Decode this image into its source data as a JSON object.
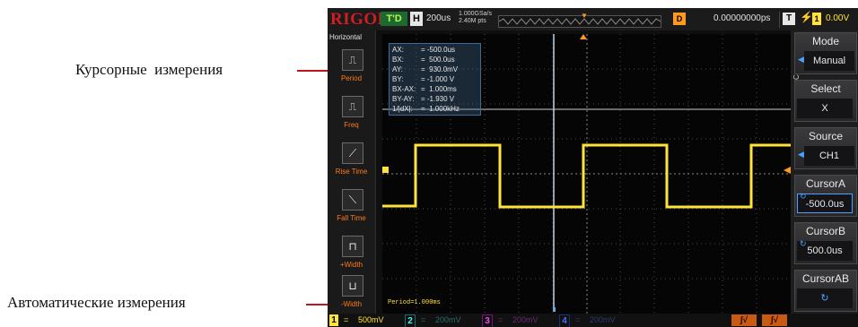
{
  "annotations": {
    "cursor_measure": "Курсорные  измерения",
    "auto_measure": "Автоматические измерения",
    "arrow_color": "#c0161b"
  },
  "scope": {
    "logo": "RIGOL",
    "trigger_status": "T'D",
    "horizontal_label": "H",
    "timebase": "200us",
    "sample_rate": "1.000GSa/s",
    "memory_depth": "2.40M pts",
    "delay_label": "D",
    "delay_value": "0.00000000ps",
    "trigger_label": "T",
    "trigger_source": "1",
    "trigger_level": "0.00V",
    "colors": {
      "ch1": "#ffe23a",
      "ch2": "#33ffff",
      "ch3": "#ff44ff",
      "ch4": "#3f73ff",
      "accent": "#d11d24"
    }
  },
  "left_menu": {
    "title": "Horizontal",
    "items": [
      {
        "label": "Period",
        "icon": "period-icon"
      },
      {
        "label": "Freq",
        "icon": "freq-icon"
      },
      {
        "label": "Rise Time",
        "icon": "rise-time-icon"
      },
      {
        "label": "Fall Time",
        "icon": "fall-time-icon"
      },
      {
        "label": "+Width",
        "icon": "pos-width-icon"
      },
      {
        "label": "-Width",
        "icon": "neg-width-icon"
      }
    ]
  },
  "cursor_readout": [
    {
      "key": "AX:",
      "value": "= -500.0us"
    },
    {
      "key": "BX:",
      "value": "=  500.0us"
    },
    {
      "key": "AY:",
      "value": "=  930.0mV"
    },
    {
      "key": "BY:",
      "value": "= -1.000 V"
    },
    {
      "key": "BX-AX:",
      "value": "=  1.000ms"
    },
    {
      "key": "BY-AY:",
      "value": "= -1.930 V"
    },
    {
      "key": "1/|dX|:",
      "value": "=  1.000kHz"
    }
  ],
  "auto_measurement": "Period=1.000ms",
  "right_menu": {
    "side_tag": "Cursor",
    "mode": {
      "title": "Mode",
      "value": "Manual"
    },
    "select": {
      "title": "Select",
      "value": "X"
    },
    "source": {
      "title": "Source",
      "value": "CH1"
    },
    "cursor_a": {
      "title": "CursorA",
      "value": "-500.0us"
    },
    "cursor_b": {
      "title": "CursorB",
      "value": "500.0us"
    },
    "cursor_ab": {
      "title": "CursorAB"
    }
  },
  "channels": [
    {
      "num": "1",
      "coupling": "=",
      "scale": "500mV"
    },
    {
      "num": "2",
      "coupling": "=",
      "scale": "200mV"
    },
    {
      "num": "3",
      "coupling": "=",
      "scale": "200mV"
    },
    {
      "num": "4",
      "coupling": "=",
      "scale": "200mV"
    }
  ]
}
